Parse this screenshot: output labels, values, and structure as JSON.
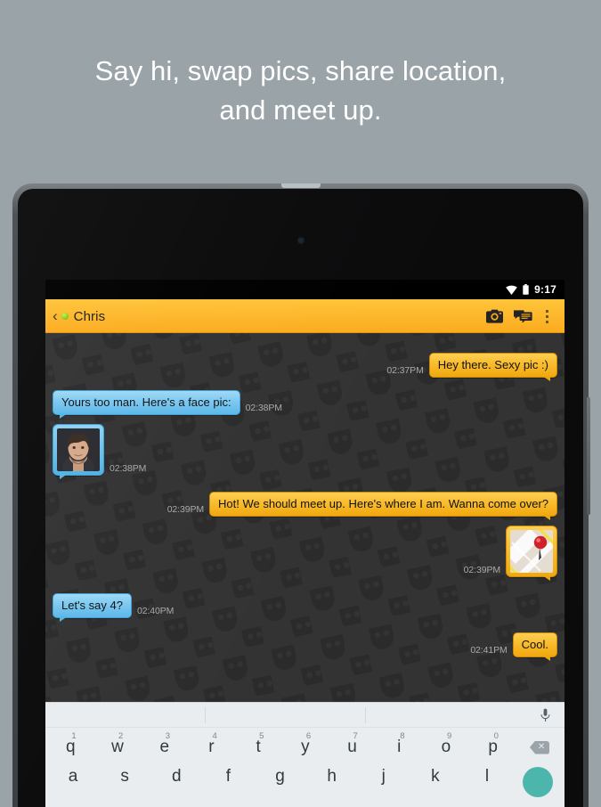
{
  "promo": {
    "headline_line1": "Say hi, swap pics, share location,",
    "headline_line2": "and meet up.",
    "background_color": "#99a3a8",
    "text_color": "#ffffff"
  },
  "device": {
    "type": "android-tablet",
    "bezel_color": "#0b0b0c",
    "frame_color": "#4e5254"
  },
  "status_bar": {
    "clock": "9:17",
    "wifi_icon": "wifi-icon",
    "battery_icon": "battery-icon",
    "background_color": "#000000"
  },
  "app_bar": {
    "back_label": "‹",
    "presence": "online",
    "presence_color": "#7cc617",
    "title": "Chris",
    "background_color": "#fbab1e",
    "actions": [
      {
        "name": "camera-button",
        "icon": "camera-icon"
      },
      {
        "name": "conversations-button",
        "icon": "chat-bubbles-icon"
      },
      {
        "name": "overflow-menu-button",
        "icon": "kebab-menu-icon"
      }
    ]
  },
  "chat": {
    "background_color": "#333333",
    "pattern": "grindr-mask-tile",
    "bubble_colors": {
      "incoming": "#5bb7e8",
      "outgoing": "#f9bc2c"
    },
    "messages": [
      {
        "side": "right",
        "type": "text",
        "text": "Hey there. Sexy pic :)",
        "time": "02:37PM"
      },
      {
        "side": "left",
        "type": "text",
        "text": "Yours too man. Here's a face pic:",
        "time": "02:38PM"
      },
      {
        "side": "left",
        "type": "photo",
        "text": "",
        "time": "02:38PM",
        "media": "face-photo-thumbnail"
      },
      {
        "side": "right",
        "type": "text",
        "text": "Hot! We should meet up. Here's where I am. Wanna come over?",
        "time": "02:39PM"
      },
      {
        "side": "right",
        "type": "map",
        "text": "",
        "time": "02:39PM",
        "media": "map-location-thumbnail"
      },
      {
        "side": "left",
        "type": "text",
        "text": "Let's say 4?",
        "time": "02:40PM"
      },
      {
        "side": "right",
        "type": "text",
        "text": "Cool.",
        "time": "02:41PM"
      }
    ]
  },
  "keyboard": {
    "background_color": "#e9edef",
    "mic_icon": "microphone-icon",
    "backspace_icon": "backspace-icon",
    "send_icon": "send-button",
    "send_color": "#4db6ac",
    "row1": [
      {
        "letter": "q",
        "num": "1"
      },
      {
        "letter": "w",
        "num": "2"
      },
      {
        "letter": "e",
        "num": "3"
      },
      {
        "letter": "r",
        "num": "4"
      },
      {
        "letter": "t",
        "num": "5"
      },
      {
        "letter": "y",
        "num": "6"
      },
      {
        "letter": "u",
        "num": "7"
      },
      {
        "letter": "i",
        "num": "8"
      },
      {
        "letter": "o",
        "num": "9"
      },
      {
        "letter": "p",
        "num": "0"
      }
    ],
    "row2": [
      "a",
      "s",
      "d",
      "f",
      "g",
      "h",
      "j",
      "k",
      "l"
    ]
  }
}
